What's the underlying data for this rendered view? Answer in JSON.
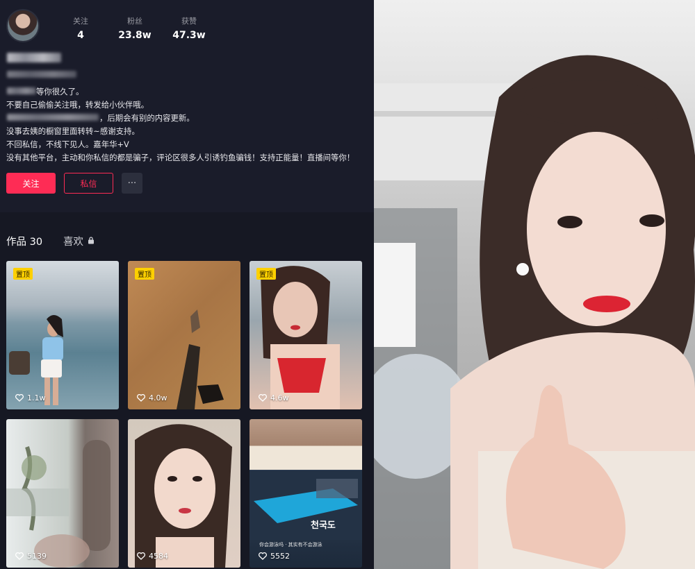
{
  "profile": {
    "stats": [
      {
        "label": "关注",
        "value": "4"
      },
      {
        "label": "粉丝",
        "value": "23.8w"
      },
      {
        "label": "获赞",
        "value": "47.3w"
      }
    ],
    "bio": {
      "line1_suffix": "等你很久了。",
      "line2": "不要自己偷偷关注哦，转发给小伙伴哦。",
      "line3_suffix": "，后期会有别的内容更新。",
      "line4": "没事去姨的橱窗里面转转~感谢支持。",
      "line5": "不回私信，不线下见人。嘉年华+V",
      "line6": "没有其他平台，主动和你私信的都是骗子，评论区很多人引诱钓鱼骗钱！支持正能量！直播间等你！"
    },
    "buttons": {
      "follow": "关注",
      "message": "私信",
      "more": "···"
    }
  },
  "tabs": {
    "works": "作品 30",
    "likes": "喜欢"
  },
  "grid": [
    {
      "pinned": "置顶",
      "likes": "1.1w"
    },
    {
      "pinned": "置顶",
      "likes": "4.0w"
    },
    {
      "pinned": "置顶",
      "likes": "4.6w"
    },
    {
      "likes": "5139"
    },
    {
      "likes": "4584"
    },
    {
      "likes": "5552",
      "overlay_title": "천국도",
      "overlay_caption": "你会游泳吗 · 其实有不会游泳"
    }
  ],
  "colors": {
    "accent": "#fe2c55",
    "pin_badge": "#fdd000",
    "panel_bg": "#161823"
  }
}
